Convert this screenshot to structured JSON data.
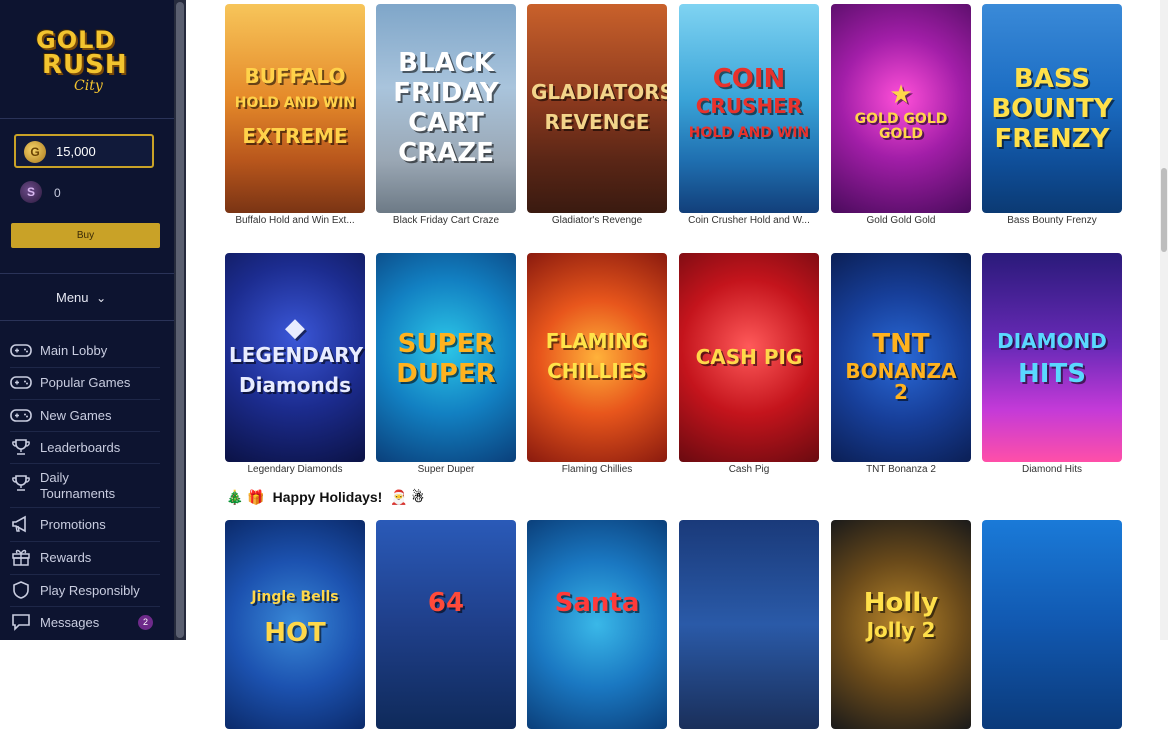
{
  "brand": {
    "logo_line1": "GOLD",
    "logo_line2": "RUSH",
    "logo_line3": "City"
  },
  "wallet": {
    "gold_coin_symbol": "G",
    "gold_balance": "15,000",
    "sweeps_coin_symbol": "S",
    "sweeps_balance": "0",
    "buy_label": "Buy"
  },
  "menu": {
    "toggle_label": "Menu",
    "chevron": "⌄"
  },
  "nav": [
    {
      "label": "Main Lobby",
      "icon": "gamepad-icon"
    },
    {
      "label": "Popular Games",
      "icon": "gamepad-icon"
    },
    {
      "label": "New Games",
      "icon": "gamepad-icon"
    },
    {
      "label": "Leaderboards",
      "icon": "trophy-icon"
    },
    {
      "label": "Daily",
      "label2": "Tournaments",
      "icon": "trophy-icon"
    },
    {
      "label": "Promotions",
      "icon": "megaphone-icon"
    },
    {
      "label": "Rewards",
      "icon": "gift-icon"
    },
    {
      "label": "Play Responsibly",
      "icon": "shield-icon"
    },
    {
      "label": "Messages",
      "icon": "chat-icon",
      "badge": "2"
    }
  ],
  "rows": [
    {
      "tiles": [
        {
          "name": "Buffalo Hold and Win Ext...",
          "art": [
            "BUFFALO",
            "HOLD AND WIN",
            "EXTREME"
          ],
          "bg": "linear-gradient(180deg,#f7c55a 0%,#e58a2a 45%,#b8561c 75%,#7a3414 100%)",
          "color": "#ffd24a"
        },
        {
          "name": "Black Friday Cart Craze",
          "art": [
            "BLACK",
            "FRIDAY",
            "CART",
            "CRAZE"
          ],
          "bg": "linear-gradient(180deg,#7fa6c9 0%,#a9c4dc 40%,#9aa7b4 75%,#6d7a86 100%)",
          "color": "#ffffff"
        },
        {
          "name": "Gladiator's Revenge",
          "art": [
            "GLADIATORS",
            "REVENGE"
          ],
          "bg": "linear-gradient(180deg,#c9612b 0%,#8d3a1e 45%,#5a2616 75%,#3a1a10 100%)",
          "color": "#f3d48a"
        },
        {
          "name": "Coin Crusher Hold and W...",
          "art": [
            "COIN",
            "CRUSHER",
            "HOLD AND WIN"
          ],
          "bg": "linear-gradient(180deg,#7fd3f2 0%,#3aa4d8 45%,#1f6fb0 75%,#123f7a 100%)",
          "color": "#e8322c"
        },
        {
          "name": "Gold Gold Gold",
          "art": [
            "★",
            "GOLD GOLD GOLD"
          ],
          "bg": "radial-gradient(circle at 50% 45%,#ff4fd8 0%,#a21ea8 45%,#4a0b5c 100%)",
          "color": "#ffd64a"
        },
        {
          "name": "Bass Bounty Frenzy",
          "art": [
            "BASS",
            "BOUNTY",
            "FRENZY"
          ],
          "bg": "linear-gradient(180deg,#3a8ad8 0%,#1b6cc2 45%,#0f4f9a 75%,#0b3a73 100%)",
          "color": "#ffe04a"
        }
      ]
    },
    {
      "tiles": [
        {
          "name": "Legendary Diamonds",
          "art": [
            "◆",
            "LEGENDARY",
            "Diamonds"
          ],
          "bg": "radial-gradient(circle at 50% 40%,#3b57d8 0%,#1c2c8f 50%,#0b1245 100%)",
          "color": "#e8ecff"
        },
        {
          "name": "Super Duper",
          "art": [
            "SUPER",
            "DUPER"
          ],
          "bg": "radial-gradient(circle at 50% 45%,#2cc7e8 0%,#1280c2 50%,#0a3f7a 100%)",
          "color": "#ffb21e"
        },
        {
          "name": "Flaming Chillies",
          "art": [
            "FLAMING",
            "CHILLIES"
          ],
          "bg": "radial-gradient(circle at 50% 50%,#ffb23a 0%,#e8561c 45%,#8a1a0e 100%)",
          "color": "#ffe34a"
        },
        {
          "name": "Cash Pig",
          "art": [
            "CASH PIG"
          ],
          "bg": "radial-gradient(circle at 50% 45%,#ff5a5a 0%,#c4141c 50%,#6a0a10 100%)",
          "color": "#ffd84a"
        },
        {
          "name": "TNT Bonanza 2",
          "art": [
            "TNT",
            "BONANZA 2"
          ],
          "bg": "radial-gradient(circle at 50% 50%,#2a6ad8 0%,#173f9a 50%,#0b1f55 100%)",
          "color": "#ffb21e"
        },
        {
          "name": "Diamond Hits",
          "art": [
            "DIAMOND",
            "HITS"
          ],
          "bg": "linear-gradient(180deg,#2a1a7a 0%,#6a2ab8 45%,#c43ad8 75%,#ff4fa8 100%)",
          "color": "#5ad8ff"
        }
      ]
    },
    {
      "tiles": [
        {
          "name": "",
          "art": [
            "Jingle Bells",
            "HOT"
          ],
          "bg": "radial-gradient(circle at 50% 50%,#3a8ad8 0%,#1c52b0 50%,#0b2a6a 100%)",
          "color": "#ffd84a"
        },
        {
          "name": "",
          "art": [
            "64"
          ],
          "bg": "linear-gradient(180deg,#2a5ab8 0%,#1f3f8a 50%,#0f2a5a 100%)",
          "color": "#ff4a3a"
        },
        {
          "name": "",
          "art": [
            "Santa"
          ],
          "bg": "radial-gradient(circle at 50% 50%,#3ab8e8 0%,#1a78c2 50%,#0b3f7a 100%)",
          "color": "#ff3a3a"
        },
        {
          "name": "",
          "art": [
            ""
          ],
          "bg": "linear-gradient(180deg,#1a3a7a 0%,#2a5aa8 50%,#1a2f5a 100%)",
          "color": "#ffffff"
        },
        {
          "name": "",
          "art": [
            "Holly",
            "Jolly 2"
          ],
          "bg": "radial-gradient(circle at 50% 50%,#b8862a 0%,#6a4a1a 50%,#1a1a1a 100%)",
          "color": "#ffe04a"
        },
        {
          "name": "",
          "art": [
            ""
          ],
          "bg": "linear-gradient(180deg,#1a7ad8 0%,#1158b0 50%,#0b3a7a 100%)",
          "color": "#ffffff"
        }
      ]
    }
  ],
  "section": {
    "title": "Happy Holidays!",
    "emoji_left": "🎄 🎁",
    "emoji_right": "🎅 ☃"
  },
  "colors": {
    "sidebar_bg": "#0d1430",
    "accent_gold": "#c9a227",
    "badge": "#6e2a8a"
  }
}
